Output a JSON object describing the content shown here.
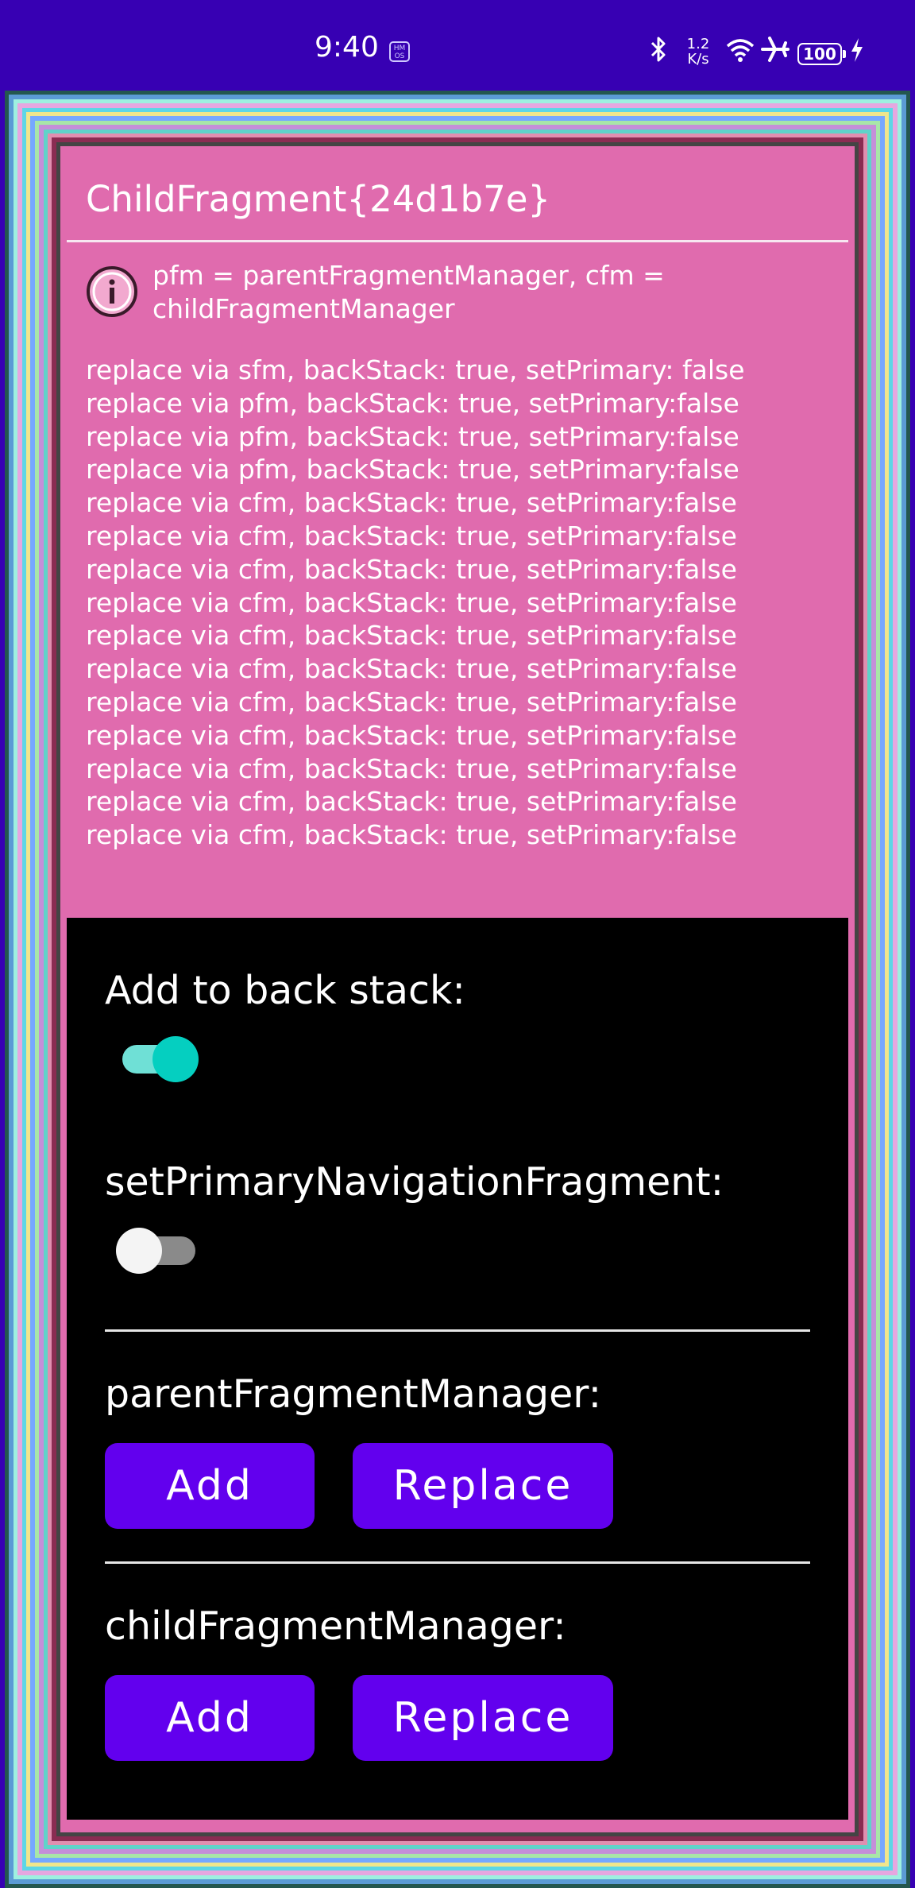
{
  "status_bar": {
    "time": "9:40",
    "hm_badge": "HM OS",
    "net_speed_value": "1.2",
    "net_speed_unit": "K/s",
    "battery": "100",
    "icons": [
      "bluetooth-icon",
      "wifi-icon",
      "airplane-icon",
      "battery-icon",
      "charging-icon"
    ]
  },
  "fragment": {
    "title": "ChildFragment{24d1b7e}",
    "info": "pfm = parentFragmentManager, cfm = childFragmentManager",
    "log": [
      "replace via sfm, backStack: true, setPrimary: false",
      "replace via pfm, backStack: true, setPrimary:false",
      "replace via pfm, backStack: true, setPrimary:false",
      "replace via pfm, backStack: true, setPrimary:false",
      "replace via cfm, backStack: true, setPrimary:false",
      "replace via cfm, backStack: true, setPrimary:false",
      "replace via cfm, backStack: true, setPrimary:false",
      "replace via cfm, backStack: true, setPrimary:false",
      "replace via cfm, backStack: true, setPrimary:false",
      "replace via cfm, backStack: true, setPrimary:false",
      "replace via cfm, backStack: true, setPrimary:false",
      "replace via cfm, backStack: true, setPrimary:false",
      "replace via cfm, backStack: true, setPrimary:false",
      "replace via cfm, backStack: true, setPrimary:false",
      "replace via cfm, backStack: true, setPrimary:false"
    ]
  },
  "controls": {
    "back_stack_label": "Add to back stack:",
    "back_stack_on": true,
    "primary_label": "setPrimaryNavigationFragment:",
    "primary_on": false,
    "parent_label": "parentFragmentManager:",
    "child_label": "childFragmentManager:",
    "add_label": "Add",
    "replace_label": "Replace"
  },
  "colors": {
    "status_bar": "#3700B3",
    "card": "#E06BAE",
    "button": "#6200EE",
    "switch_on": "#05CFC0",
    "frame_rings": [
      "#24574f",
      "#5b9bd5",
      "#9ef0e0",
      "#e6a7e0",
      "#5dd6e6",
      "#f0e68c",
      "#76a8ff",
      "#a8e6a8",
      "#c48fd9",
      "#5fd3c9",
      "#e08fb0",
      "#8a2c52",
      "#444444",
      "#e06bae"
    ]
  }
}
